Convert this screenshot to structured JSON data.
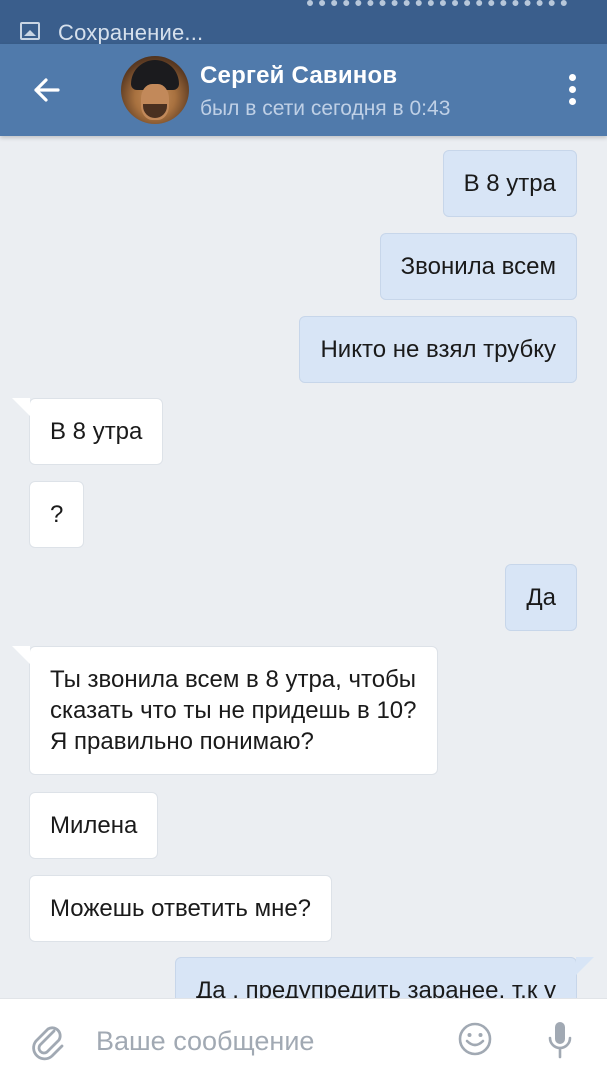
{
  "status_bar": {
    "text": "Сохранение..."
  },
  "header": {
    "contact_name": "Сергей Савинов",
    "contact_status": "был в сети сегодня в 0:43"
  },
  "messages": [
    {
      "direction": "out",
      "text": "В 8 утра"
    },
    {
      "direction": "out",
      "text": "Звонила всем"
    },
    {
      "direction": "out",
      "text": "Никто не взял трубку"
    },
    {
      "direction": "in",
      "text": "В 8 утра"
    },
    {
      "direction": "in",
      "text": "?"
    },
    {
      "direction": "out",
      "text": "Да"
    },
    {
      "direction": "in",
      "lines": [
        "Ты звонила всем в 8 утра, чтобы",
        "сказать что ты не придешь в 10?",
        "Я правильно понимаю?"
      ]
    },
    {
      "direction": "in",
      "text": "Милена"
    },
    {
      "direction": "in",
      "text": "Можешь ответить мне?"
    },
    {
      "direction": "out",
      "text": "Да , предупредить заранее, т.к у"
    }
  ],
  "input_bar": {
    "placeholder": "Ваше сообщение"
  },
  "icons": {
    "back": "arrow-left-icon",
    "more": "more-vertical-icon",
    "attach": "paperclip-icon",
    "emoji": "smiley-icon",
    "mic": "microphone-icon"
  },
  "colors": {
    "header": "#507aab",
    "status_bar": "#3a5e8c",
    "background": "#ebeef2",
    "outgoing_bubble": "#d8e5f6",
    "incoming_bubble": "#ffffff"
  }
}
